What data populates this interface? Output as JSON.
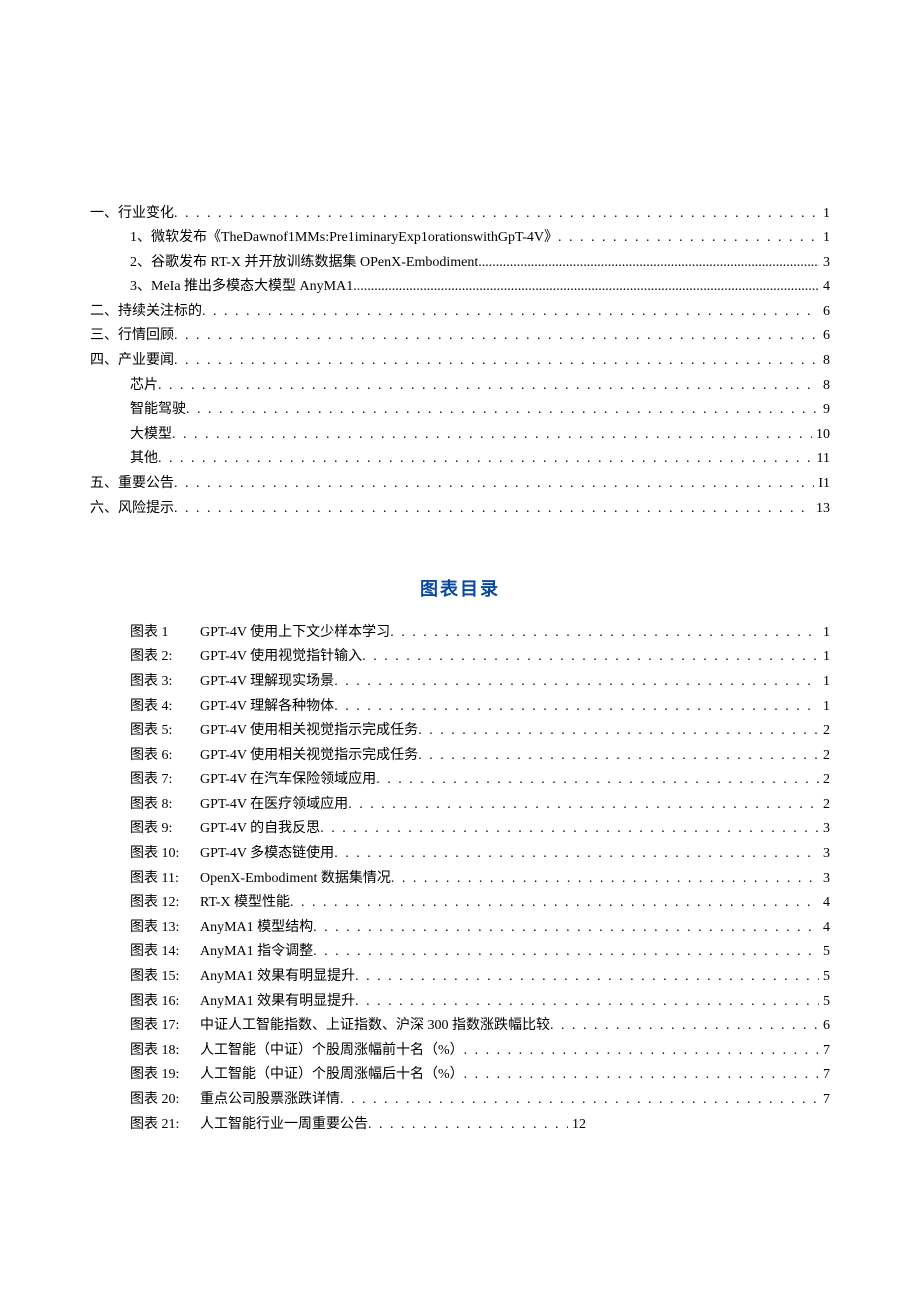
{
  "toc": [
    {
      "level": 0,
      "label": "一、行业变化",
      "dots": "s",
      "page": "1"
    },
    {
      "level": 1,
      "label": "1、微软发布《TheDawnof1MMs:Pre1iminaryExp1orationswithGpT-4V》",
      "dots": "s",
      "page": "1"
    },
    {
      "level": 1,
      "label": "2、谷歌发布 RT-X 并开放训练数据集 OPenX-Embodiment",
      "dots": "d",
      "page": "3"
    },
    {
      "level": 1,
      "label": "3、MeIa 推出多模态大模型 AnyMA1",
      "dots": "d",
      "page": "4"
    },
    {
      "level": 0,
      "label": "二、持续关注标的",
      "dots": "s",
      "page": "6"
    },
    {
      "level": 0,
      "label": "三、行情回顾",
      "dots": "s",
      "page": "6"
    },
    {
      "level": 0,
      "label": "四、产业要闻",
      "dots": "s",
      "page": "8"
    },
    {
      "level": 1,
      "label": "芯片",
      "dots": "s",
      "page": "8"
    },
    {
      "level": 1,
      "label": "智能驾驶",
      "dots": "s",
      "page": "9"
    },
    {
      "level": 1,
      "label": "大模型",
      "dots": "s",
      "page": "10"
    },
    {
      "level": 1,
      "label": "其他",
      "dots": "s",
      "page": "11"
    },
    {
      "level": 0,
      "label": "五、重要公告",
      "dots": "s",
      "page": "I1"
    },
    {
      "level": 0,
      "label": "六、风险提示",
      "dots": "s",
      "page": "13"
    }
  ],
  "figures_title": "图表目录",
  "figures": [
    {
      "num": "图表 1",
      "title": "GPT-4V 使用上下文少样本学习",
      "page": "1"
    },
    {
      "num": "图表 2:",
      "title": "GPT-4V 使用视觉指针输入",
      "page": "1"
    },
    {
      "num": "图表 3:",
      "title": "GPT-4V 理解现实场景",
      "page": "1"
    },
    {
      "num": "图表 4:",
      "title": "GPT-4V 理解各种物体",
      "page": "1"
    },
    {
      "num": "图表 5:",
      "title": "GPT-4V 使用相关视觉指示完成任务",
      "page": "2"
    },
    {
      "num": "图表 6:",
      "title": "GPT-4V 使用相关视觉指示完成任务",
      "page": "2"
    },
    {
      "num": "图表 7:",
      "title": "GPT-4V 在汽车保险领域应用",
      "page": "2"
    },
    {
      "num": "图表 8:",
      "title": "GPT-4V 在医疗领域应用",
      "page": "2"
    },
    {
      "num": "图表 9:",
      "title": "GPT-4V 的自我反思",
      "page": "3"
    },
    {
      "num": "图表 10:",
      "title": "GPT-4V 多模态链使用",
      "page": "3"
    },
    {
      "num": "图表 11:",
      "title": "OpenX-Embodiment 数据集情况",
      "page": "3"
    },
    {
      "num": "图表 12:",
      "title": "RT-X 模型性能",
      "page": "4"
    },
    {
      "num": "图表 13:",
      "title": "AnyMA1 模型结构",
      "page": "4"
    },
    {
      "num": "图表 14:",
      "title": "AnyMA1 指令调整",
      "page": "5"
    },
    {
      "num": "图表 15:",
      "title": "AnyMA1 效果有明显提升",
      "page": "5"
    },
    {
      "num": "图表 16:",
      "title": "AnyMA1 效果有明显提升",
      "page": "5"
    },
    {
      "num": "图表 17:",
      "title": "中证人工智能指数、上证指数、沪深 300 指数涨跌幅比较",
      "page": "6"
    },
    {
      "num": "图表 18:",
      "title": "人工智能（中证）个股周涨幅前十名（%）",
      "page": "7"
    },
    {
      "num": "图表 19:",
      "title": "人工智能（中证）个股周涨幅后十名（%）",
      "page": "7"
    },
    {
      "num": "图表 20:",
      "title": "重点公司股票涨跌详情",
      "page": "7"
    },
    {
      "num": "图表 21:",
      "title": "人工智能行业一周重要公告",
      "page": "12",
      "short": true
    }
  ]
}
